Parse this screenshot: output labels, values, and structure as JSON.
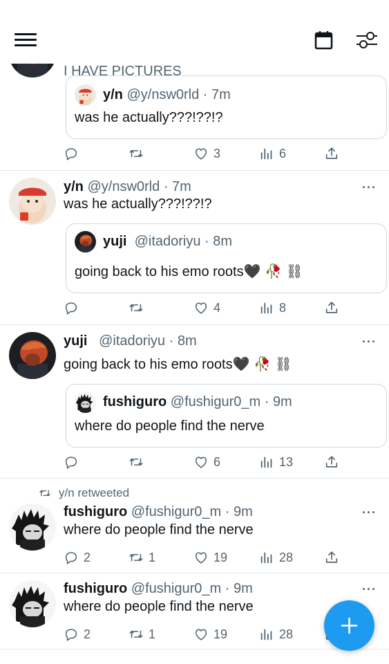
{
  "colors": {
    "accent": "#1d9bf0",
    "muted": "#536471",
    "text": "#0f1419",
    "divider": "#e6e8eb"
  },
  "topbar": {
    "menu_icon": "hamburger-menu-icon",
    "calendar_icon": "calendar-icon",
    "filter_icon": "sliders-icon"
  },
  "tweets": [
    {
      "text": "I HAVE PICTURES",
      "quote": {
        "name": "y/n",
        "handle": "@y/nsw0rld",
        "time": "7m",
        "text": "was he actually???!??!?"
      },
      "stats": {
        "replies": "",
        "retweets": "",
        "likes": "3",
        "views": "6"
      }
    },
    {
      "name": "y/n",
      "handle": "@y/nsw0rld",
      "time": "7m",
      "text": "was he actually???!??!?",
      "more": "···",
      "quote": {
        "name": "yuji",
        "handle": "@itadoriyu",
        "time": "8m",
        "text": "going back to his emo roots🖤 🥀 ⛓"
      },
      "stats": {
        "replies": "",
        "retweets": "",
        "likes": "4",
        "views": "8"
      }
    },
    {
      "name": "yuji",
      "handle": "@itadoriyu",
      "time": "8m",
      "text": "going back to his emo roots🖤 🥀 ⛓",
      "more": "···",
      "quote": {
        "name": "fushiguro",
        "handle": "@fushigur0_m",
        "time": "9m",
        "text": "where do people find the nerve"
      },
      "stats": {
        "replies": "",
        "retweets": "",
        "likes": "6",
        "views": "13"
      }
    },
    {
      "retweeted_by": "y/n retweeted",
      "name": "fushiguro",
      "handle": "@fushigur0_m",
      "time": "9m",
      "text": "where do people find the nerve",
      "more": "···",
      "stats": {
        "replies": "2",
        "retweets": "1",
        "likes": "19",
        "views": "28"
      }
    },
    {
      "name": "fushiguro",
      "handle": "@fushigur0_m",
      "time": "9m",
      "text": "where do people find the nerve",
      "more": "···",
      "stats": {
        "replies": "2",
        "retweets": "1",
        "likes": "19",
        "views": "28"
      }
    }
  ],
  "fab": {
    "icon": "plus-icon"
  }
}
